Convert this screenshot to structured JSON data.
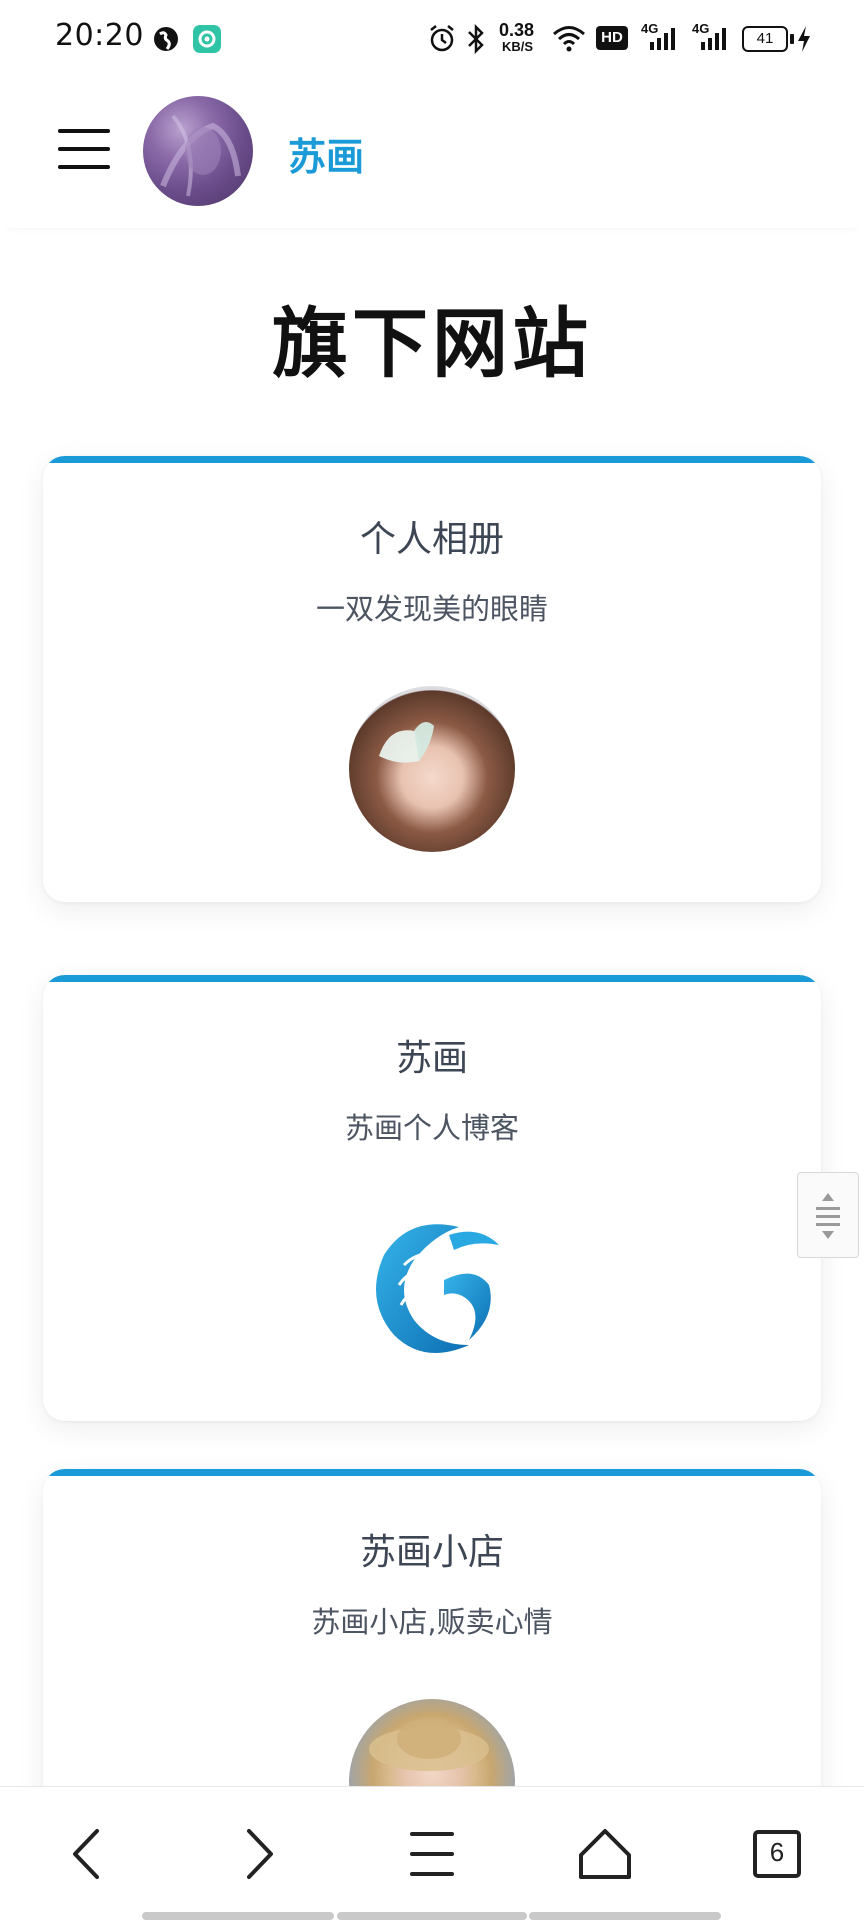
{
  "status_bar": {
    "time": "20:20",
    "speed_value": "0.38",
    "speed_unit": "KB/S",
    "hd_label": "HD",
    "net1": "4G",
    "net2": "4G",
    "battery": "41"
  },
  "header": {
    "site_name": "苏画"
  },
  "page_title": "旗下网站",
  "cards": [
    {
      "title": "个人相册",
      "subtitle": "一双发现美的眼睛",
      "image": "portrait-with-butterfly-photo"
    },
    {
      "title": "苏画",
      "subtitle": "苏画个人博客",
      "image": "blue-swirl-logo"
    },
    {
      "title": "苏画小店",
      "subtitle": "苏画小店,贩卖心情",
      "image": "girl-in-straw-hat-photo"
    }
  ],
  "bottom_nav": {
    "tab_count": "6"
  },
  "colors": {
    "accent": "#1a9ad6",
    "title_text": "#111111",
    "card_text": "#3d4654"
  }
}
